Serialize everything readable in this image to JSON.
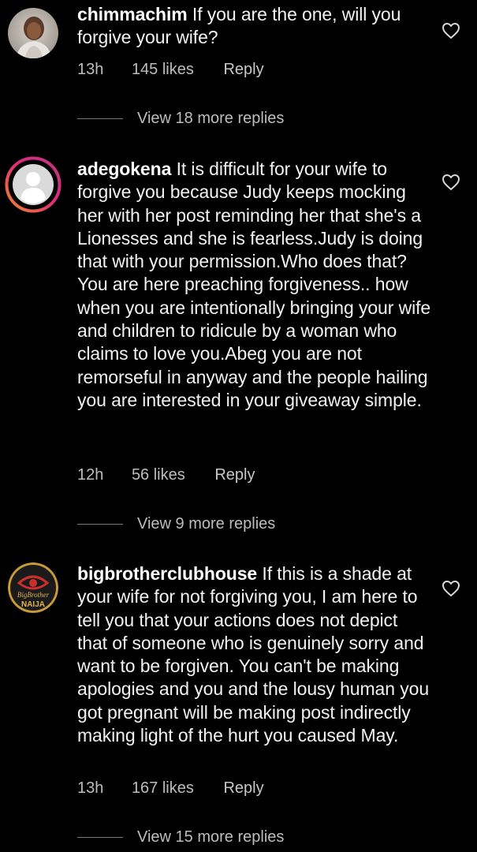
{
  "comments": [
    {
      "username": "chimmachim",
      "text": "If you are the one, will you forgive your wife?",
      "time": "13h",
      "likes": "145 likes",
      "reply": "Reply",
      "view_replies": "View 18 more replies",
      "avatar_icon": "user-photo-avatar"
    },
    {
      "username": "adegokena",
      "text": "It is difficult for your wife to forgive you because Judy keeps mocking her with her post reminding her that she's a Lionesses and she is fearless.Judy is doing that with your permission.Who does that? You are here preaching forgiveness.. how when you are intentionally bringing your wife and children to ridicule by a woman who claims to love you.Abeg you are not remorseful in anyway and the people hailing you are interested in your giveaway simple.",
      "time": "12h",
      "likes": "56 likes",
      "reply": "Reply",
      "view_replies": "View 9 more replies",
      "avatar_icon": "default-profile-avatar"
    },
    {
      "username": "bigbrotherclubhouse",
      "text": "If this is a shade at your wife for not forgiving you, I am here to tell you that your actions does not depict that of someone who is genuinely sorry and want to be forgiven. You can't be making apologies and you and the lousy human you got pregnant will be making post indirectly making light of the hurt you caused May.",
      "time": "13h",
      "likes": "167 likes",
      "reply": "Reply",
      "view_replies": "View 15 more replies",
      "avatar_icon": "big-brother-naija-logo",
      "avatar_logo_text": [
        "BigBrother",
        "NAIJA"
      ]
    }
  ],
  "colors": {
    "background": "#000000",
    "text": "#ffffff",
    "meta": "#bdbdbd",
    "story_ring_start": "#f58529",
    "story_ring_end": "#dd2a7b"
  }
}
